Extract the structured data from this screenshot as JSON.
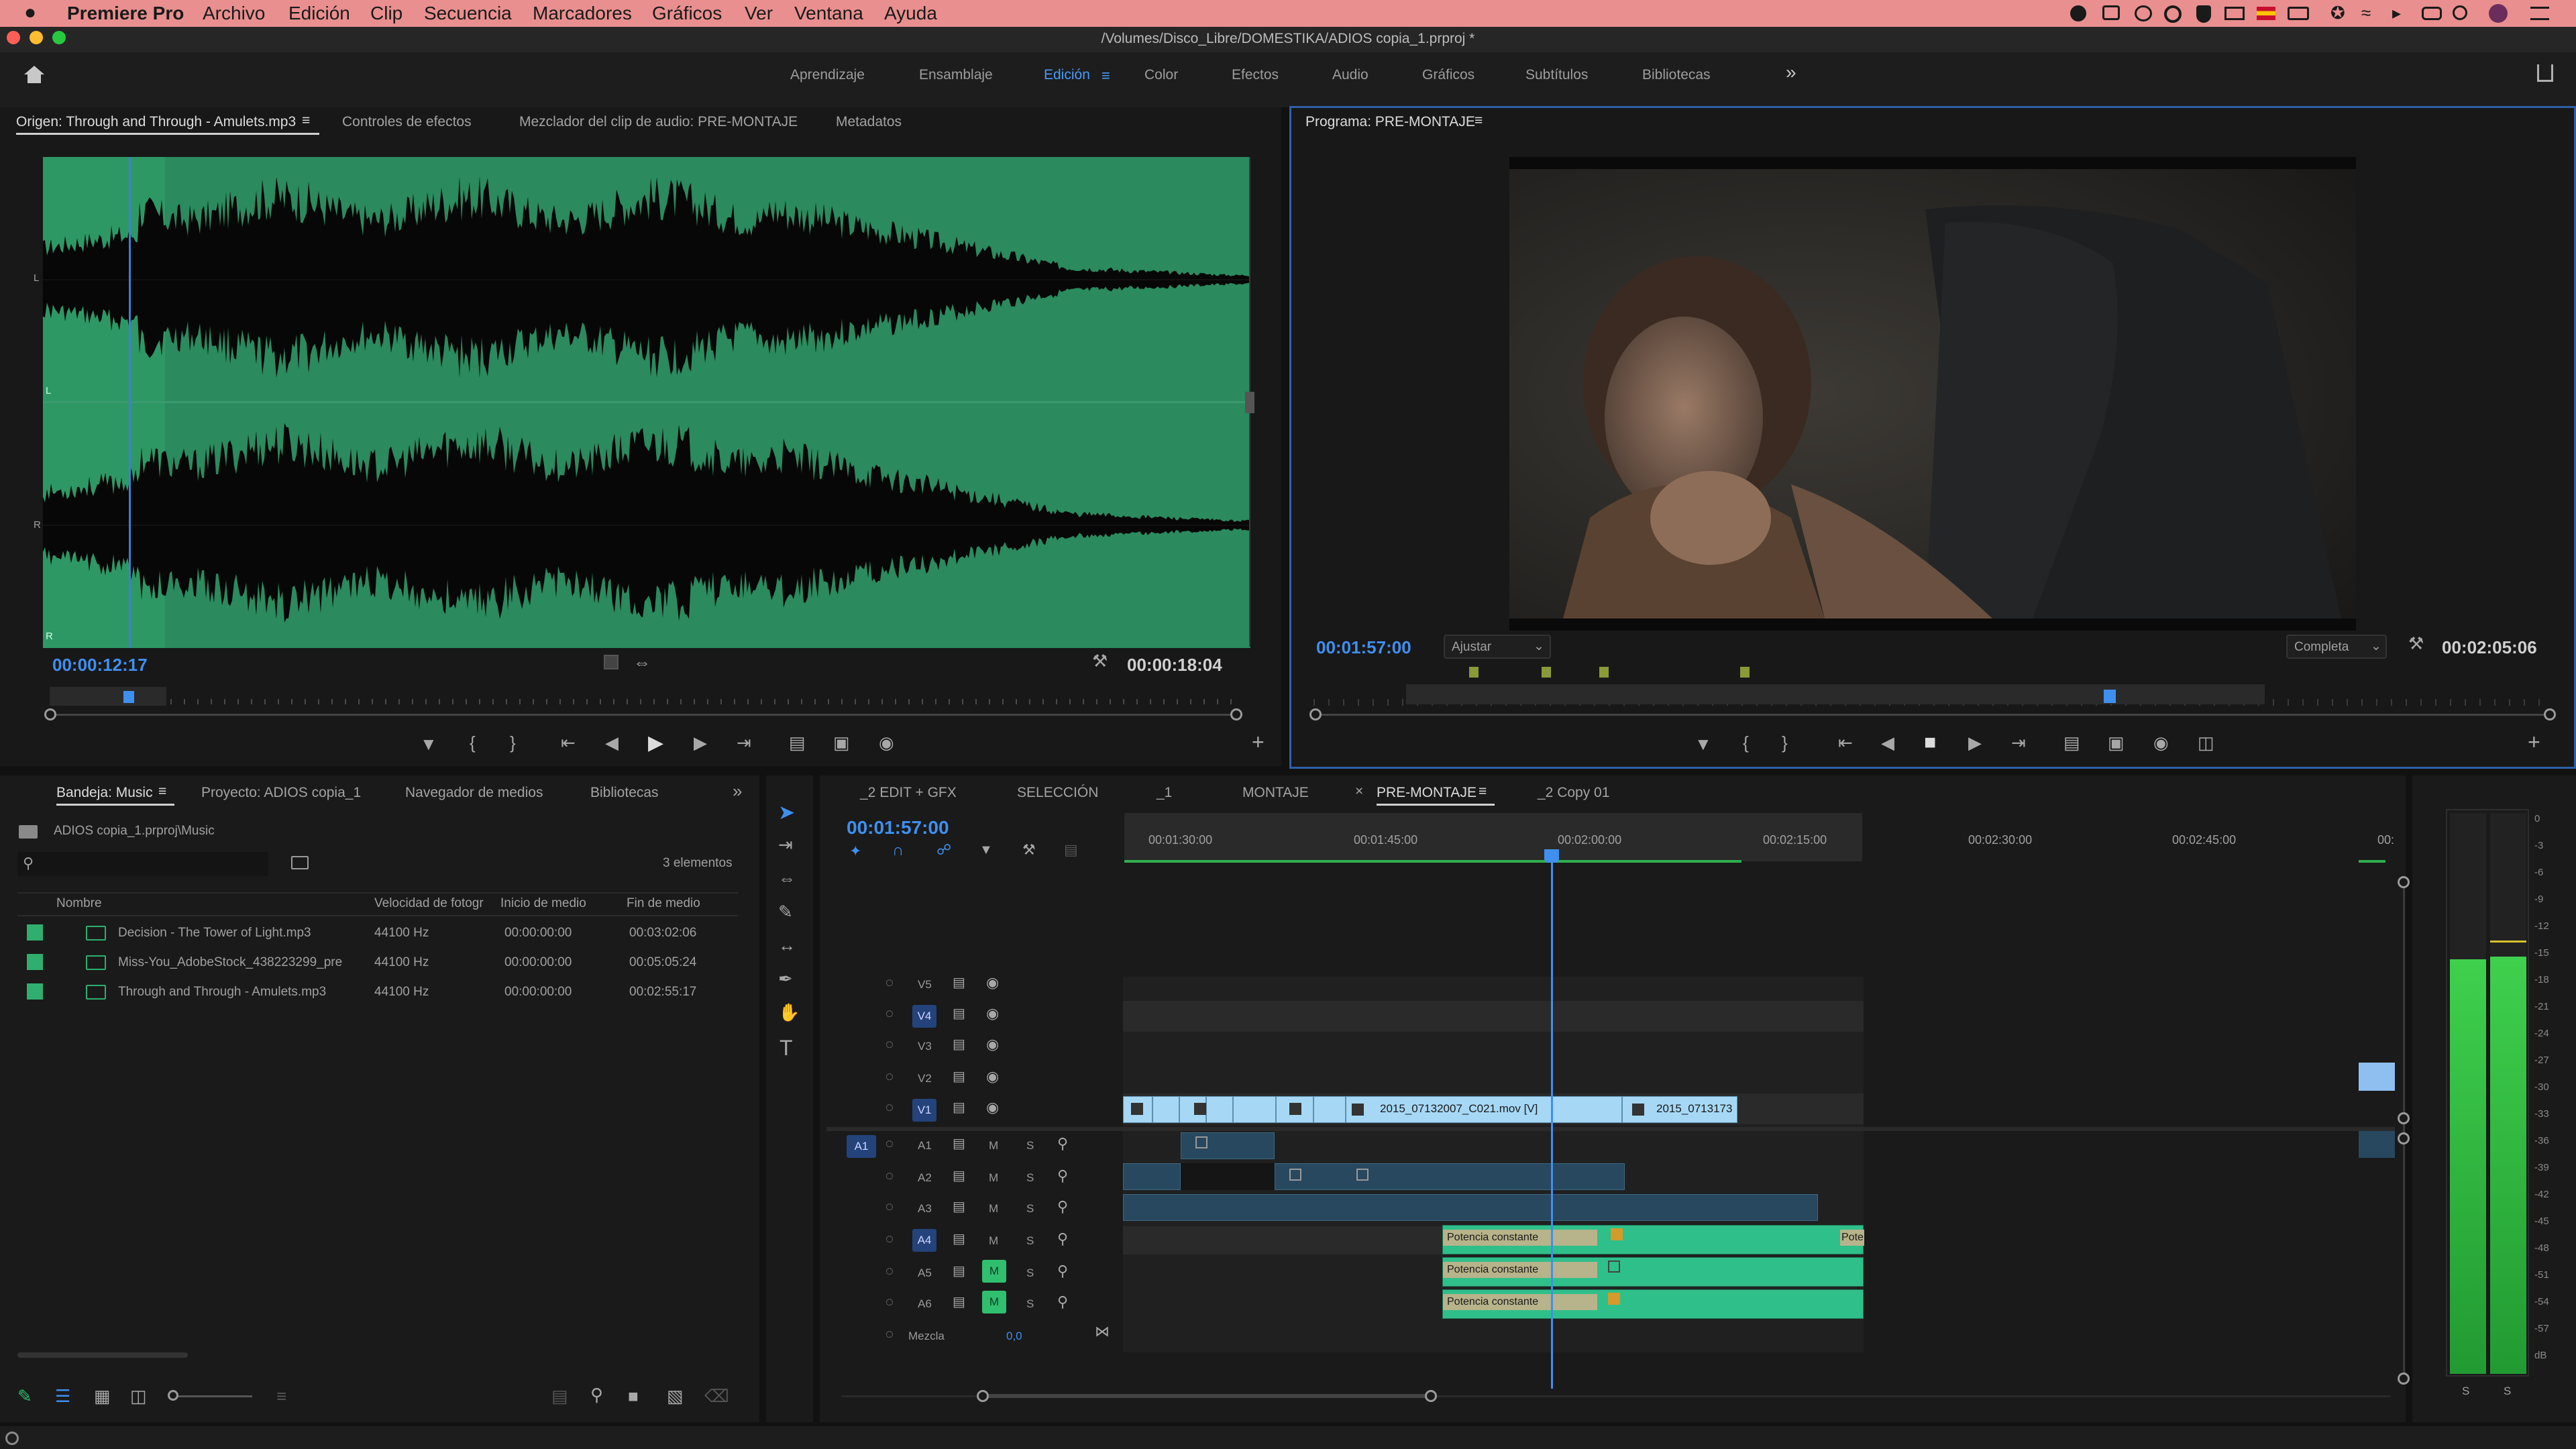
{
  "menubar": {
    "apple": "",
    "app_name": "Premiere Pro",
    "items": [
      "Archivo",
      "Edición",
      "Clip",
      "Secuencia",
      "Marcadores",
      "Gráficos",
      "Ver",
      "Ventana",
      "Ayuda"
    ]
  },
  "window": {
    "title": "/Volumes/Disco_Libre/DOMESTIKA/ADIOS copia_1.prproj *"
  },
  "workspaces": {
    "items": [
      "Aprendizaje",
      "Ensamblaje",
      "Edición",
      "Color",
      "Efectos",
      "Audio",
      "Gráficos",
      "Subtítulos",
      "Bibliotecas"
    ],
    "active": "Edición",
    "more": "»"
  },
  "source_panel": {
    "tabs": [
      "Origen: Through and Through - Amulets.mp3",
      "Controles de efectos",
      "Mezclador del clip de audio: PRE-MONTAJE",
      "Metadatos"
    ],
    "playhead_timecode": "00:00:12:17",
    "duration_timecode": "00:00:18:04",
    "channel_labels": [
      "L",
      "L",
      "R",
      "R"
    ],
    "waveform_color": "#2a8a5c"
  },
  "program_panel": {
    "title": "Programa: PRE-MONTAJE",
    "playhead_timecode": "00:01:57:00",
    "fit_value": "Ajustar",
    "resolution_value": "Completa",
    "duration_timecode": "00:02:05:06"
  },
  "project_panel": {
    "tabs": [
      "Bandeja: Music",
      "Proyecto: ADIOS copia_1",
      "Navegador de medios",
      "Bibliotecas"
    ],
    "path": "ADIOS copia_1.prproj\\Music",
    "count": "3 elementos",
    "columns": [
      "Nombre",
      "Velocidad de fotogr",
      "Inicio de medio",
      "Fin de medio"
    ],
    "rows": [
      {
        "name": "Decision - The Tower of Light.mp3",
        "rate": "44100 Hz",
        "start": "00:00:00:00",
        "end": "00:03:02:06"
      },
      {
        "name": "Miss-You_AdobeStock_438223299_pre",
        "rate": "44100 Hz",
        "start": "00:00:00:00",
        "end": "00:05:05:24"
      },
      {
        "name": "Through and Through - Amulets.mp3",
        "rate": "44100 Hz",
        "start": "00:00:00:00",
        "end": "00:02:55:17"
      }
    ],
    "label_color": "#2fae6e"
  },
  "timeline": {
    "tabs": [
      "_2 EDIT + GFX",
      "SELECCIÓN",
      "_1",
      "MONTAJE",
      "PRE-MONTAJE",
      "_2 Copy 01"
    ],
    "active_tab": "PRE-MONTAJE",
    "playhead_timecode": "00:01:57:00",
    "ruler": [
      "00:01:30:00",
      "00:01:45:00",
      "00:02:00:00",
      "00:02:15:00",
      "00:02:30:00",
      "00:02:45:00",
      "00:"
    ],
    "video_tracks": [
      "V5",
      "V4",
      "V3",
      "V2",
      "V1"
    ],
    "audio_tracks": [
      "A1",
      "A2",
      "A3",
      "A4",
      "A5",
      "A6"
    ],
    "source_patch": "A1",
    "mix_label": "Mezcla",
    "mix_value": "0,0",
    "clips": {
      "v1_a": "2015_07132007_C021.mov [V]",
      "v1_b": "2015_0713173",
      "audio_fx": "Potencia constante",
      "audio_fx_short": "Pote"
    },
    "mute_label": "M",
    "solo_label": "S"
  },
  "audio_meter": {
    "scale": [
      "0",
      "-3",
      "-6",
      "-9",
      "-12",
      "-15",
      "-18",
      "-21",
      "-24",
      "-27",
      "-30",
      "-33",
      "-36",
      "-39",
      "-42",
      "-45",
      "-48",
      "-51",
      "-54",
      "-57",
      "dB"
    ],
    "solo_labels": [
      "S",
      "S"
    ],
    "level_color": "#34c24f"
  },
  "colors": {
    "accent": "#3f8ff0",
    "video_clip": "#a6d8f6",
    "audio_clip": "#27485f",
    "audio_green": "#2fbf8a"
  }
}
